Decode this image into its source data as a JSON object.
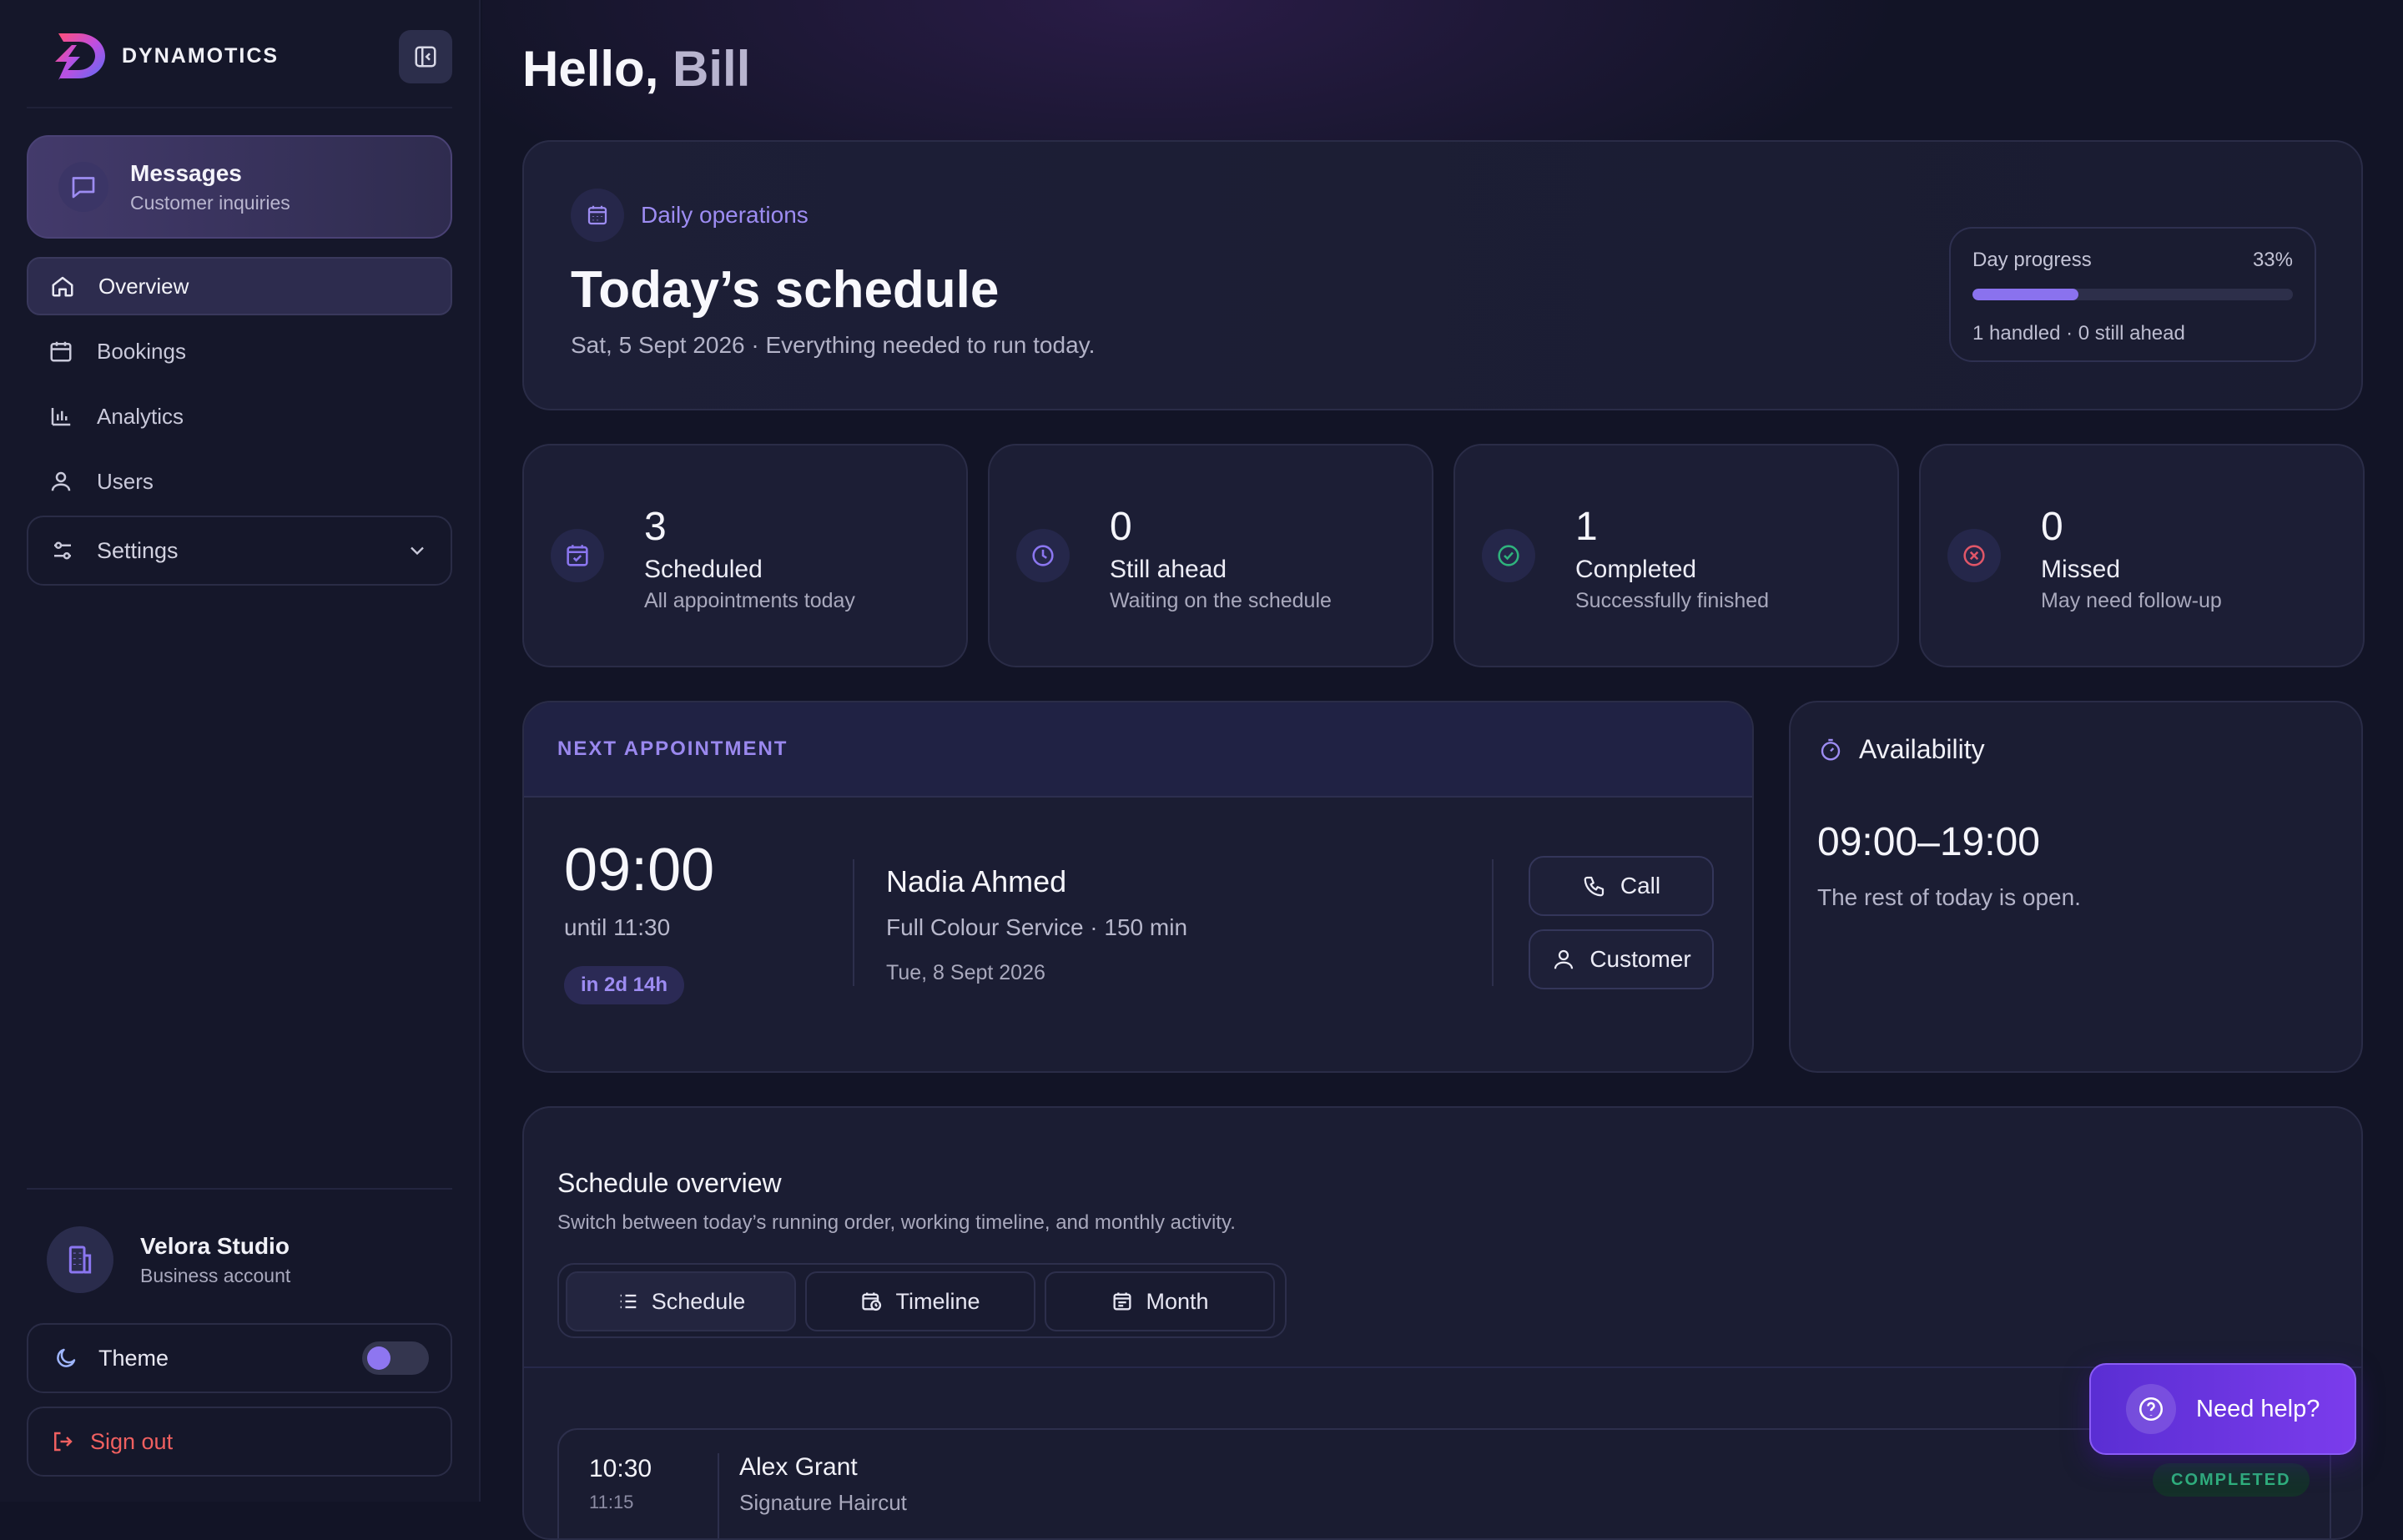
{
  "brand": {
    "name": "DYNAMOTICS"
  },
  "sidebar": {
    "messages": {
      "title": "Messages",
      "subtitle": "Customer inquiries"
    },
    "nav": [
      {
        "label": "Overview",
        "icon": "home-icon",
        "active": true
      },
      {
        "label": "Bookings",
        "icon": "calendar-icon",
        "active": false
      },
      {
        "label": "Analytics",
        "icon": "bar-chart-icon",
        "active": false
      },
      {
        "label": "Users",
        "icon": "user-icon",
        "active": false
      }
    ],
    "settings": {
      "label": "Settings",
      "icon": "sliders-icon"
    },
    "account": {
      "name": "Velora Studio",
      "subtitle": "Business account"
    },
    "theme": {
      "label": "Theme"
    },
    "signout": {
      "label": "Sign out"
    }
  },
  "greeting": {
    "prefix": "Hello,",
    "name": "Bill"
  },
  "hero": {
    "tag": "Daily operations",
    "title": "Today’s schedule",
    "subtitle": "Sat, 5 Sept 2026 · Everything needed to run today.",
    "progress": {
      "label": "Day progress",
      "percent_label": "33%",
      "fraction": 0.33,
      "footer": "1 handled · 0 still ahead"
    }
  },
  "stats": [
    {
      "value": "3",
      "title": "Scheduled",
      "subtitle": "All appointments today",
      "icon": "calendar-check-icon",
      "color": "#8b76f0"
    },
    {
      "value": "0",
      "title": "Still ahead",
      "subtitle": "Waiting on the schedule",
      "icon": "clock-icon",
      "color": "#8b76f0"
    },
    {
      "value": "1",
      "title": "Completed",
      "subtitle": "Successfully finished",
      "icon": "check-circle-icon",
      "color": "#2fb37d"
    },
    {
      "value": "0",
      "title": "Missed",
      "subtitle": "May need follow-up",
      "icon": "x-circle-icon",
      "color": "#e05668"
    }
  ],
  "next_appointment": {
    "heading": "NEXT APPOINTMENT",
    "time": "09:00",
    "until": "until 11:30",
    "countdown": "in 2d 14h",
    "customer": "Nadia Ahmed",
    "service": "Full Colour Service · 150 min",
    "date": "Tue, 8 Sept 2026",
    "call_label": "Call",
    "customer_label": "Customer"
  },
  "availability": {
    "title": "Availability",
    "hours": "09:00–19:00",
    "note": "The rest of today is open."
  },
  "schedule_overview": {
    "title": "Schedule overview",
    "subtitle": "Switch between today’s running order, working timeline, and monthly activity.",
    "tabs": [
      {
        "label": "Schedule",
        "icon": "list-icon",
        "active": true
      },
      {
        "label": "Timeline",
        "icon": "calendar-clock-icon",
        "active": false
      },
      {
        "label": "Month",
        "icon": "calendar-icon",
        "active": false
      }
    ],
    "rows": [
      {
        "time": "10:30",
        "end": "11:15",
        "name": "Alex Grant",
        "service": "Signature Haircut",
        "status": "COMPLETED"
      }
    ]
  },
  "help": {
    "label": "Need help?"
  },
  "colors": {
    "accent": "#8a72ee",
    "success": "#2fb37d",
    "danger": "#e05668",
    "background": "#121426"
  }
}
